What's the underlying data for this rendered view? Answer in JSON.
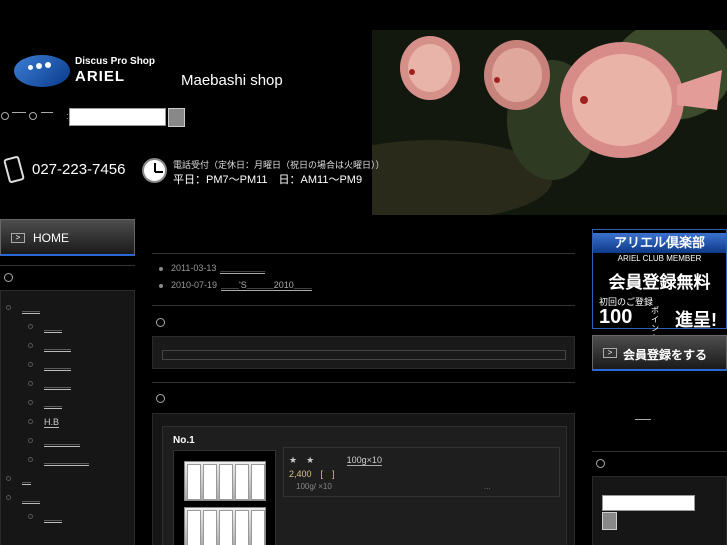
{
  "header": {
    "logo_line1": "Discus Pro Shop",
    "logo_line2": "ARIEL",
    "shop_name": "Maebashi shop",
    "search_separator": ":",
    "phone": "027-223-7456",
    "hours_line1": "電話受付（定休日：月曜日（祝日の場合は火曜日））",
    "hours_line2": "平日：PM7〜PM11　日：AM11〜PM9"
  },
  "left_sidebar": {
    "home_label": "HOME",
    "menu_items": [
      {
        "label": "＿＿",
        "level": 0
      },
      {
        "label": "＿＿",
        "level": 1
      },
      {
        "label": "＿＿＿",
        "level": 1
      },
      {
        "label": "＿＿＿",
        "level": 1
      },
      {
        "label": "＿＿＿",
        "level": 1
      },
      {
        "label": "＿＿",
        "level": 1
      },
      {
        "label": "H.B",
        "level": 1
      },
      {
        "label": "＿＿＿＿",
        "level": 1
      },
      {
        "label": "＿＿＿＿＿",
        "level": 1
      },
      {
        "label": "＿",
        "level": 0
      },
      {
        "label": "＿＿",
        "level": 0
      },
      {
        "label": "＿＿",
        "level": 1
      }
    ]
  },
  "news": [
    {
      "date": "2011-03-13",
      "text": "＿＿＿＿＿"
    },
    {
      "date": "2010-07-19",
      "text": "＿＿'S＿＿＿2010＿＿"
    }
  ],
  "product": {
    "number": "No.1",
    "title_stars": "★　★",
    "title_text": "100g×10",
    "price": "2,400　[　]",
    "desc": "100g/ ×10",
    "more": "..."
  },
  "right_sidebar": {
    "club_title": "アリエル倶楽部",
    "club_sub": "ARIEL CLUB MEMBER",
    "club_free": "会員登録無料",
    "club_first": "初回のご登録",
    "club_points": "100",
    "club_unit": "ポイント",
    "club_gift": "進呈!",
    "register_label": "会員登録をする"
  },
  "colors": {
    "background": "#000000",
    "accent_blue": "#2a6ad8",
    "price_gold": "#d9c38a"
  }
}
